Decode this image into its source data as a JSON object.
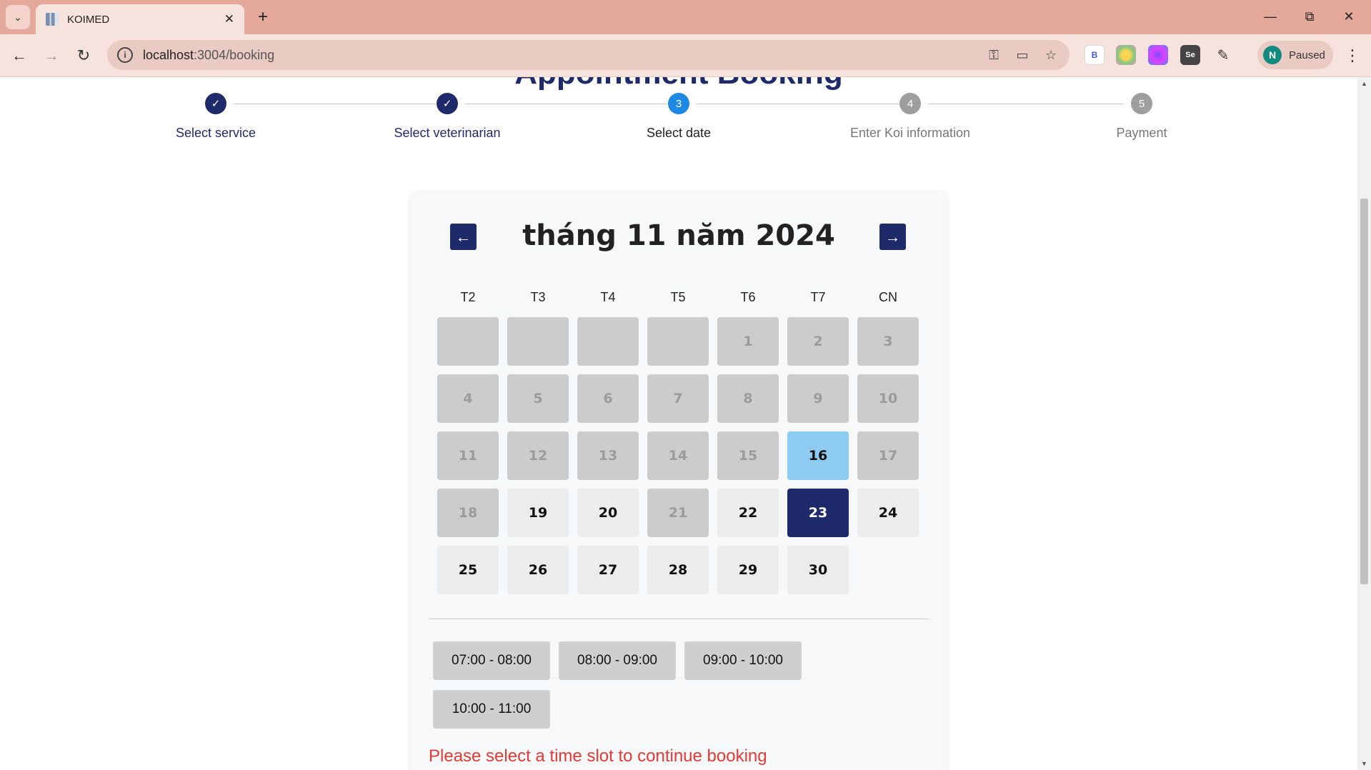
{
  "browser": {
    "tab_title": "KOIMED",
    "url_host": "localhost",
    "url_path": ":3004/booking",
    "profile_initial": "N",
    "profile_status": "Paused"
  },
  "page": {
    "heading": "Appointment Booking",
    "steps": [
      {
        "number": "1",
        "label": "Select service",
        "state": "done"
      },
      {
        "number": "2",
        "label": "Select veterinarian",
        "state": "done"
      },
      {
        "number": "3",
        "label": "Select date",
        "state": "active"
      },
      {
        "number": "4",
        "label": "Enter Koi information",
        "state": "todo"
      },
      {
        "number": "5",
        "label": "Payment",
        "state": "todo"
      }
    ],
    "calendar": {
      "month_title": "tháng 11 năm 2024",
      "weekdays": [
        "T2",
        "T3",
        "T4",
        "T5",
        "T6",
        "T7",
        "CN"
      ],
      "days": [
        {
          "label": "",
          "state": "empty"
        },
        {
          "label": "",
          "state": "empty"
        },
        {
          "label": "",
          "state": "empty"
        },
        {
          "label": "",
          "state": "empty"
        },
        {
          "label": "1",
          "state": "disabled"
        },
        {
          "label": "2",
          "state": "disabled"
        },
        {
          "label": "3",
          "state": "disabled"
        },
        {
          "label": "4",
          "state": "disabled"
        },
        {
          "label": "5",
          "state": "disabled"
        },
        {
          "label": "6",
          "state": "disabled"
        },
        {
          "label": "7",
          "state": "disabled"
        },
        {
          "label": "8",
          "state": "disabled"
        },
        {
          "label": "9",
          "state": "disabled"
        },
        {
          "label": "10",
          "state": "disabled"
        },
        {
          "label": "11",
          "state": "disabled"
        },
        {
          "label": "12",
          "state": "disabled"
        },
        {
          "label": "13",
          "state": "disabled"
        },
        {
          "label": "14",
          "state": "disabled"
        },
        {
          "label": "15",
          "state": "disabled"
        },
        {
          "label": "16",
          "state": "today"
        },
        {
          "label": "17",
          "state": "disabled"
        },
        {
          "label": "18",
          "state": "disabled"
        },
        {
          "label": "19",
          "state": "avail"
        },
        {
          "label": "20",
          "state": "avail"
        },
        {
          "label": "21",
          "state": "disabled"
        },
        {
          "label": "22",
          "state": "avail"
        },
        {
          "label": "23",
          "state": "selected"
        },
        {
          "label": "24",
          "state": "avail"
        },
        {
          "label": "25",
          "state": "avail"
        },
        {
          "label": "26",
          "state": "avail"
        },
        {
          "label": "27",
          "state": "avail"
        },
        {
          "label": "28",
          "state": "avail"
        },
        {
          "label": "29",
          "state": "avail"
        },
        {
          "label": "30",
          "state": "avail"
        }
      ]
    },
    "time_slots": [
      "07:00 - 08:00",
      "08:00 - 09:00",
      "09:00 - 10:00",
      "10:00 - 11:00"
    ],
    "error_message": "Please select a time slot to continue booking"
  },
  "colors": {
    "primary": "#1f2a6b",
    "active_step": "#1e88e5",
    "today": "#8ecbf0",
    "error": "#e53935"
  }
}
